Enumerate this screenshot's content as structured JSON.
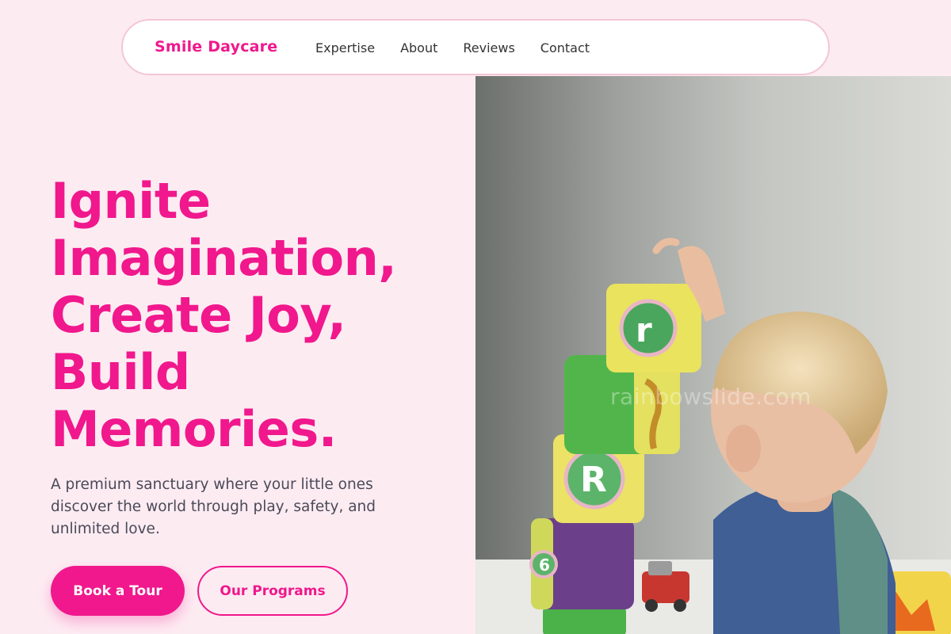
{
  "nav": {
    "brand": "Smile Daycare",
    "links": [
      "Expertise",
      "About",
      "Reviews",
      "Contact"
    ]
  },
  "hero": {
    "title_lines": [
      "Ignite",
      "Imagination,",
      "Create Joy,",
      "Build",
      "Memories."
    ],
    "subtitle": "A premium sanctuary where your little ones discover the world through play, safety, and unlimited love.",
    "primary_button": "Book a Tour",
    "secondary_button": "Our Programs"
  },
  "image": {
    "watermark": "rainbowslide.com",
    "block_letters": [
      "r",
      "R",
      "6"
    ]
  },
  "colors": {
    "accent": "#f0188c",
    "background": "#fdebf2",
    "nav_border": "#f3c6d6",
    "text": "#4a4a58"
  }
}
